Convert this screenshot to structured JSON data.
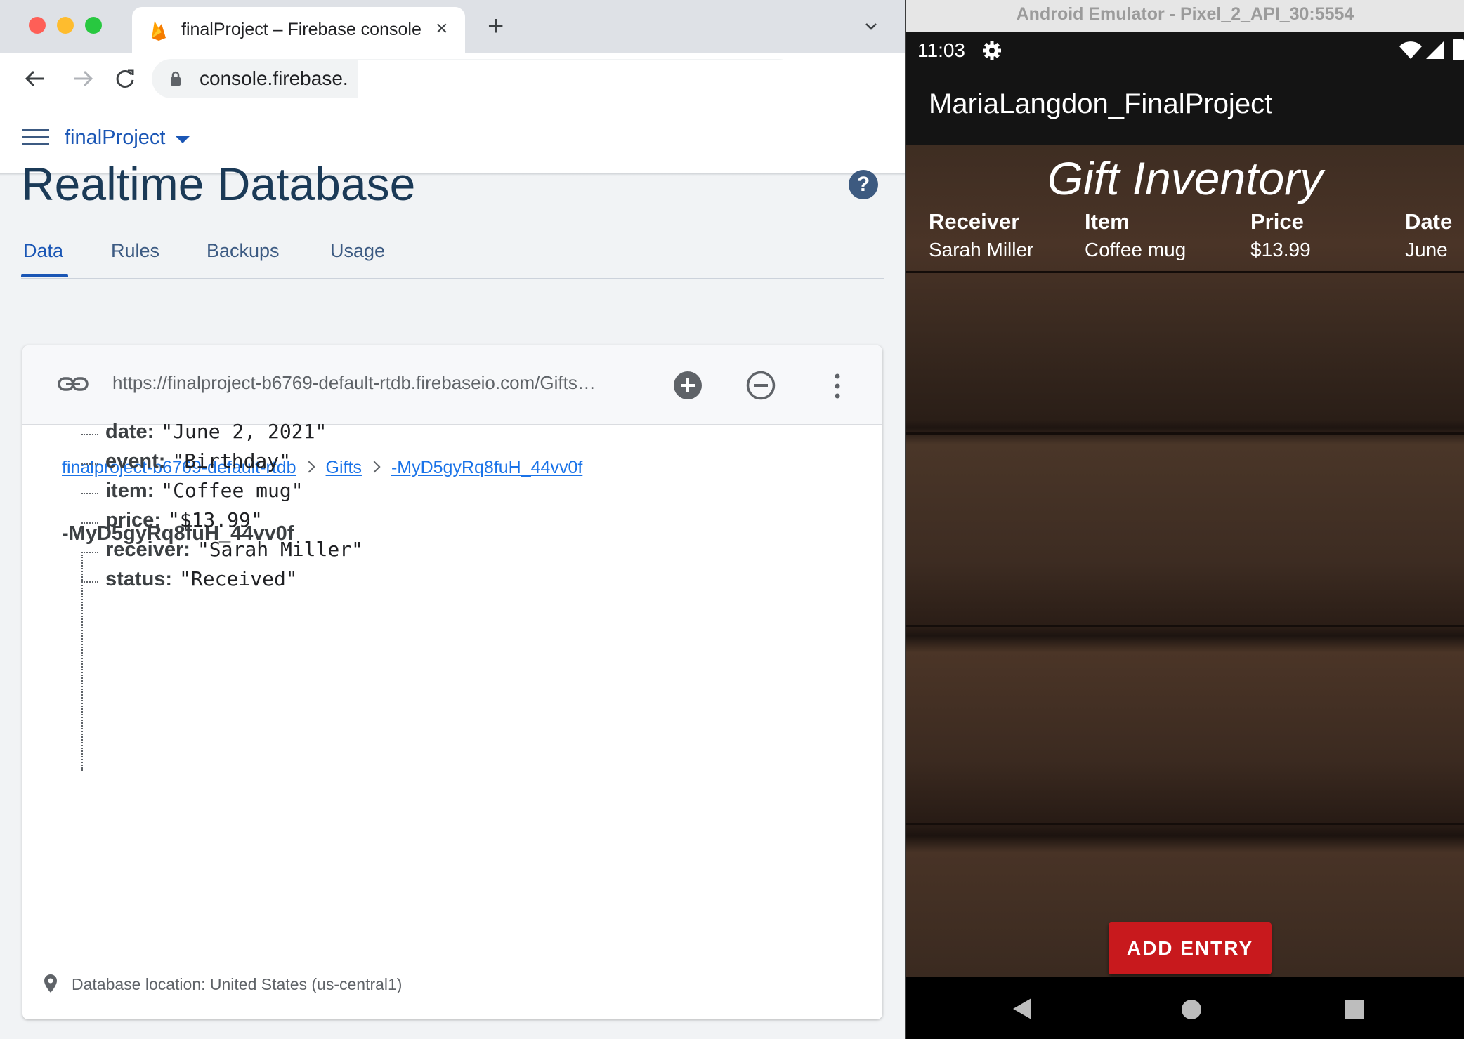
{
  "browser": {
    "tab_title": "finalProject – Firebase console",
    "url": "console.firebase.",
    "tab_close": "×",
    "new_tab": "+"
  },
  "firebase": {
    "project_name": "finalProject",
    "page_title": "Realtime Database",
    "help": "?",
    "tabs": [
      {
        "label": "Data",
        "active": true
      },
      {
        "label": "Rules",
        "active": false
      },
      {
        "label": "Backups",
        "active": false
      },
      {
        "label": "Usage",
        "active": false
      }
    ],
    "db_url": "https://finalproject-b6769-default-rtdb.firebaseio.com/Gifts…",
    "breadcrumb": [
      "finalproject-b6769-default-rtdb",
      "Gifts",
      "-MyD5gyRq8fuH_44vv0f"
    ],
    "node_key": "-MyD5gyRq8fuH_44vv0f",
    "fields": [
      {
        "key": "date:",
        "value": "\"June 2, 2021\""
      },
      {
        "key": "event:",
        "value": "\"Birthday\""
      },
      {
        "key": "item:",
        "value": "\"Coffee mug\""
      },
      {
        "key": "price:",
        "value": "\"$13.99\""
      },
      {
        "key": "receiver:",
        "value": "\"Sarah Miller\""
      },
      {
        "key": "status:",
        "value": "\"Received\""
      }
    ],
    "db_location": "Database location: United States (us-central1)",
    "accent_color": "#1a56b5"
  },
  "emulator": {
    "window_title": "Android Emulator - Pixel_2_API_30:5554",
    "clock": "11:03",
    "app_title": "MariaLangdon_FinalProject",
    "inventory_title": "Gift Inventory",
    "columns": [
      "Receiver",
      "Item",
      "Price",
      "Date"
    ],
    "row": [
      "Sarah Miller",
      "Coffee mug",
      "$13.99",
      "June"
    ],
    "add_entry_label": "ADD ENTRY",
    "button_color": "#c8191d"
  }
}
